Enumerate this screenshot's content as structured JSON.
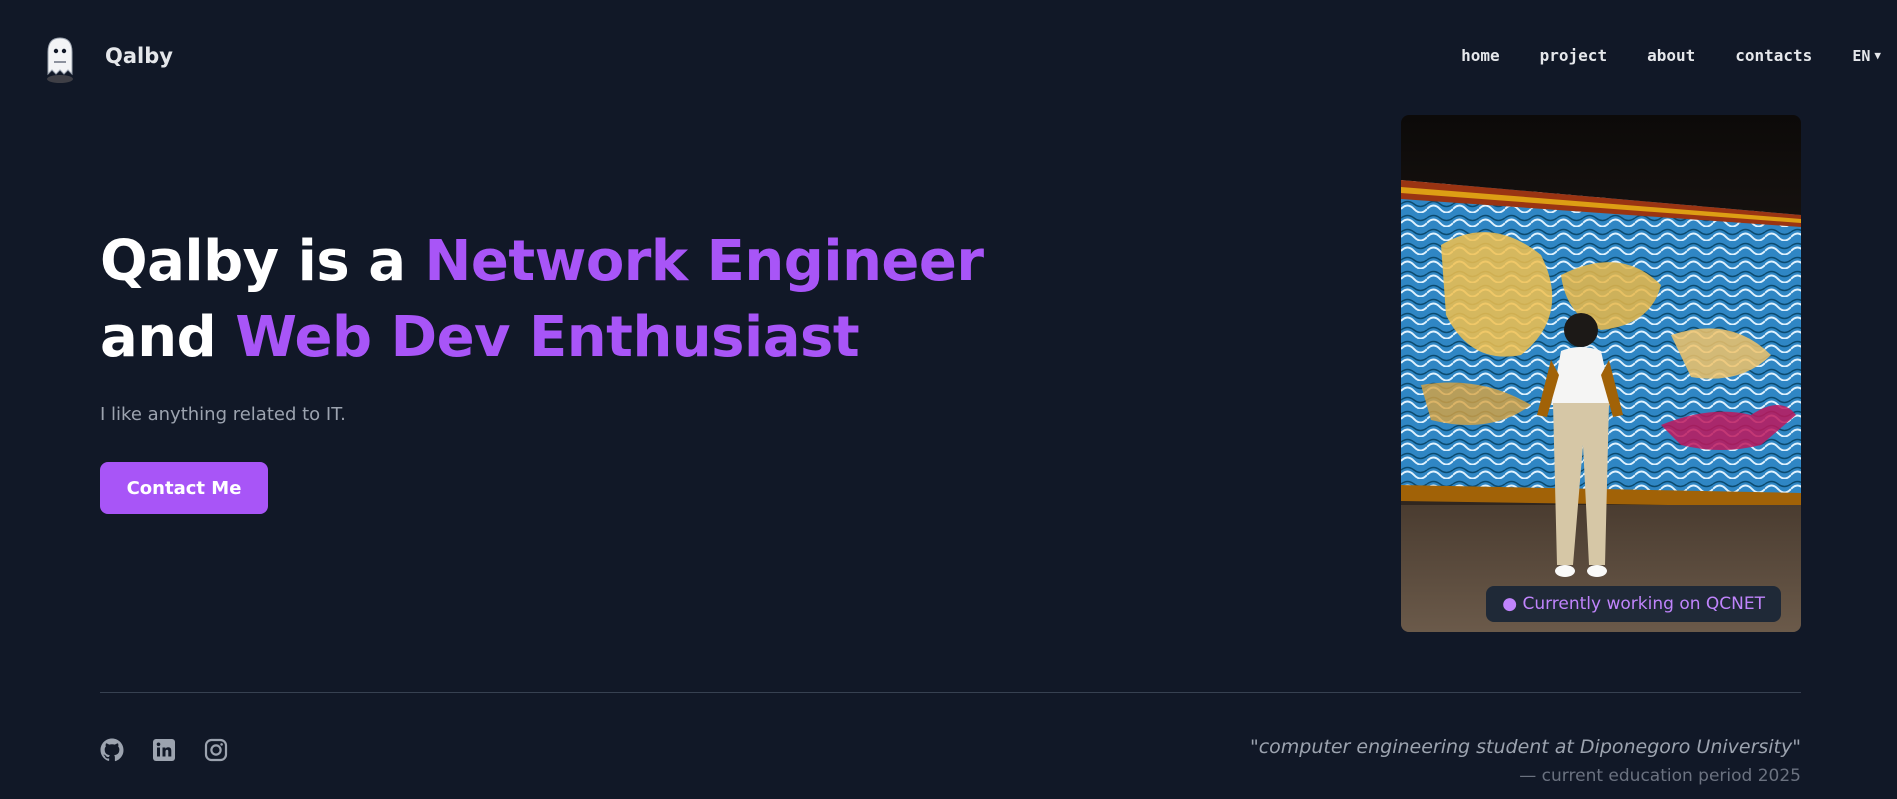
{
  "nav": {
    "brand": "Qalby",
    "logo_icon": "ghost-icon",
    "items": [
      {
        "label": "home"
      },
      {
        "label": "project"
      },
      {
        "label": "about"
      },
      {
        "label": "contacts"
      }
    ],
    "language": "EN",
    "language_icon": "caret-down-icon"
  },
  "hero": {
    "title_part1": "Qalby is a ",
    "title_highlight1": "Network Engineer",
    "title_part2": "and ",
    "title_highlight2": "Web Dev Enthusiast",
    "tagline": "I like anything related to IT.",
    "cta_label": "Contact Me"
  },
  "photo": {
    "status_text": "● Currently working on QCNET"
  },
  "footer": {
    "socials": [
      {
        "icon": "github-icon"
      },
      {
        "icon": "linkedin-icon"
      },
      {
        "icon": "instagram-icon"
      }
    ],
    "quote": "\"computer engineering student at Diponegoro University\"",
    "period": "— current education period 2025"
  },
  "colors": {
    "background": "#111827",
    "accent": "#a855f7",
    "muted_text": "#9ca3af",
    "divider": "#374151"
  }
}
